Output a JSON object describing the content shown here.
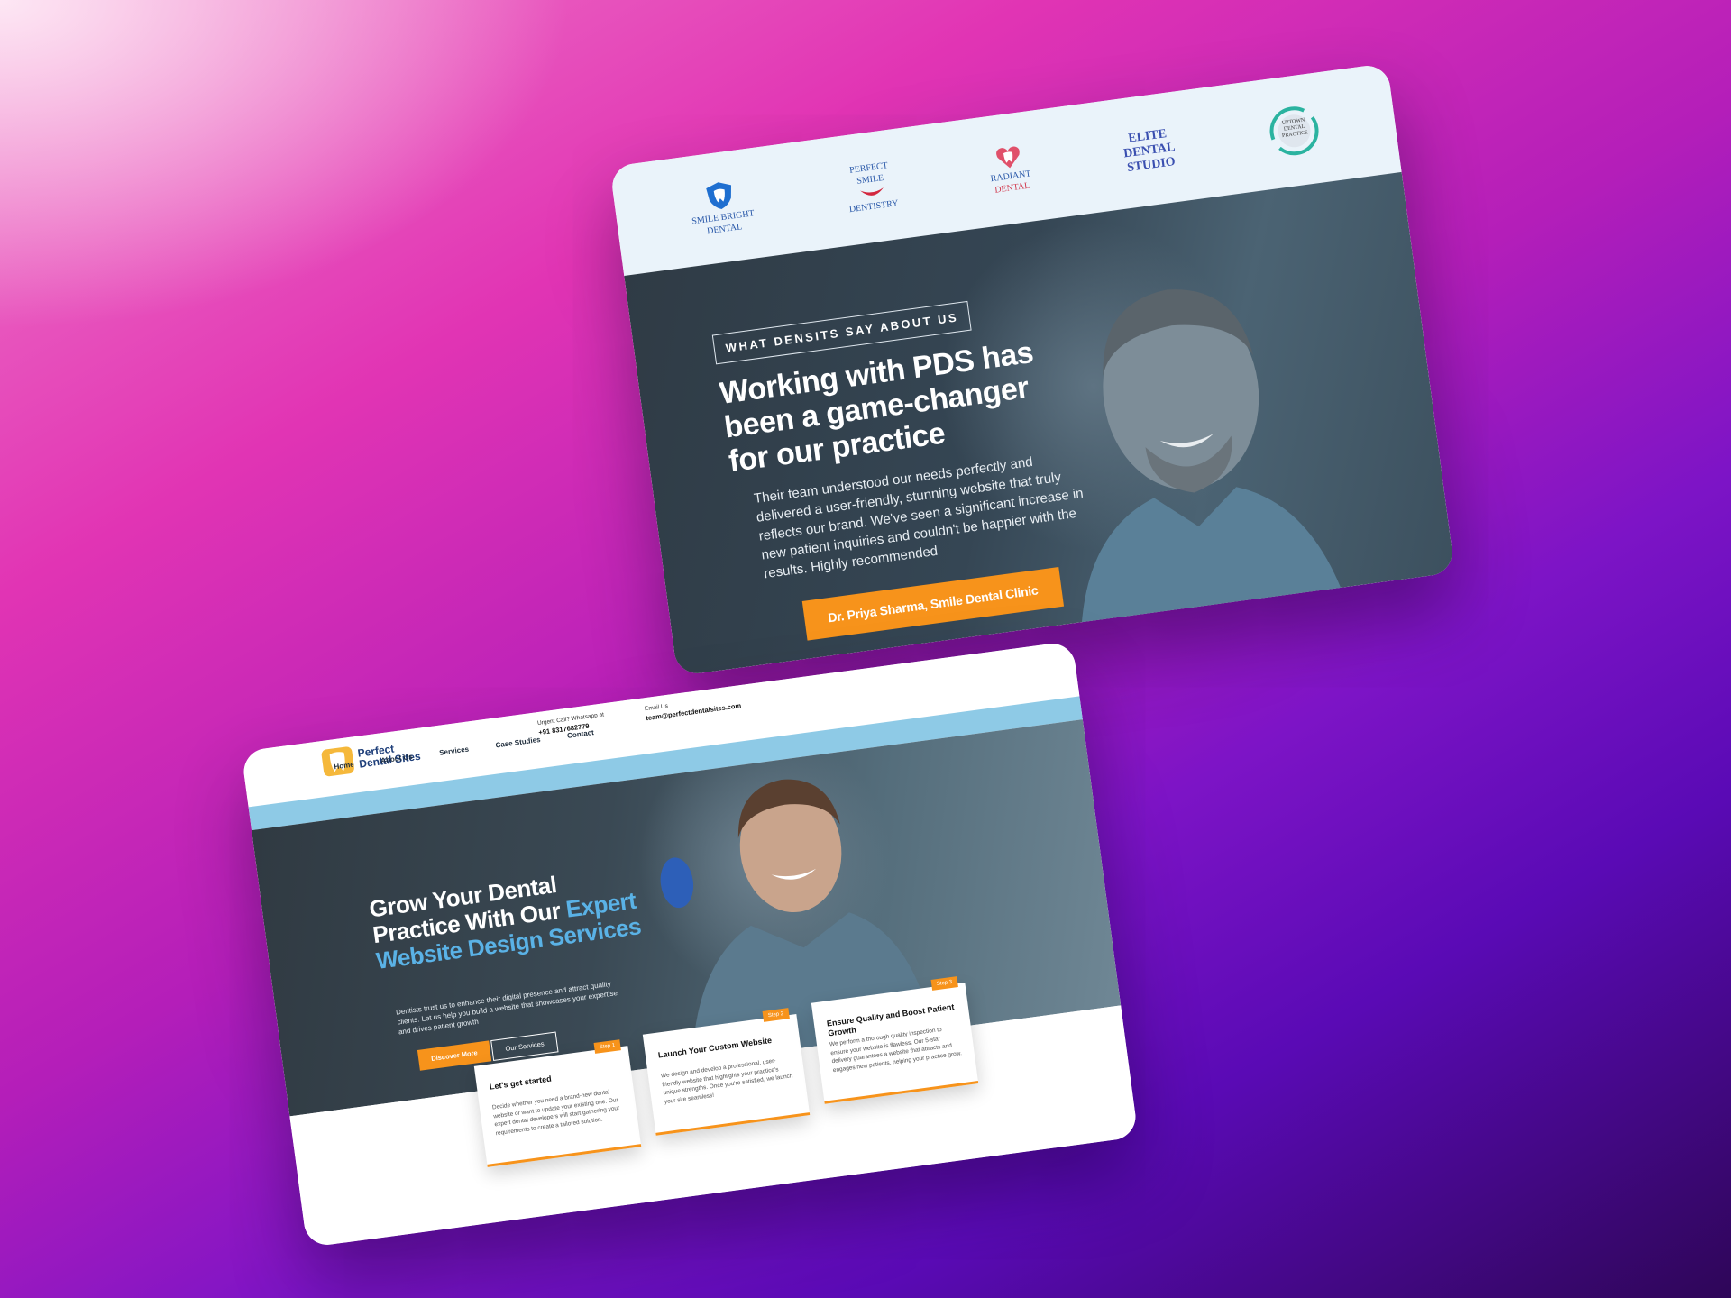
{
  "testimonial": {
    "logos": [
      {
        "icon": "shield-tooth-icon",
        "line1": "SMILE BRIGHT",
        "line2": "DENTAL"
      },
      {
        "icon": "smile-icon",
        "line1": "PERFECT",
        "line2": "SMILE",
        "line3": "DENTISTRY"
      },
      {
        "icon": "tooth-heart-icon",
        "line1": "RADIANT",
        "line2": "DENTAL"
      },
      {
        "icon": "none",
        "line1": "ELITE",
        "line2": "DENTAL",
        "line3": "STUDIO"
      },
      {
        "icon": "circle-tooth-icon",
        "line1": "UPTOWN",
        "line2": "DENTAL",
        "line3": "PRACTICE"
      }
    ],
    "eyebrow": "WHAT DENSITS SAY ABOUT US",
    "title": "Working with PDS has been a game-changer for our practice",
    "body": "Their team understood our needs perfectly and delivered a user-friendly, stunning website that truly reflects our brand. We've seen a significant increase in new patient inquiries and couldn't be happier with the results. Highly recommended",
    "author_button": "Dr. Priya Sharma, Smile Dental Clinic"
  },
  "home": {
    "brand": {
      "line1": "Perfect",
      "line2": "Dental Sites"
    },
    "contact_phone": {
      "label": "Urgent Call? Whatsapp at",
      "value": "+91 8317682779"
    },
    "contact_email": {
      "label": "Email Us",
      "value": "team@perfectdentalsites.com"
    },
    "nav": [
      "Home",
      "About Us",
      "Services",
      "Case Studies",
      "Contact"
    ],
    "hero_title_plain": "Grow Your Dental Practice With Our",
    "hero_title_highlight": "Expert Website Design Services",
    "hero_body": "Dentists trust us to enhance their digital presence and attract quality clients. Let us help you build a website that showcases your expertise and drives patient growth",
    "btn_primary": "Discover More",
    "btn_secondary": "Our Services",
    "steps": [
      {
        "tag": "Step 1",
        "title": "Let's get started",
        "body": "Decide whether you need a brand-new dental website or want to update your existing one. Our expert dental developers will start gathering your requirements to create a tailored solution."
      },
      {
        "tag": "Step 2",
        "title": "Launch Your Custom Website",
        "body": "We design and develop a professional, user-friendly website that highlights your practice's unique strengths. Once you're satisfied, we launch your site seamless!"
      },
      {
        "tag": "Step 3",
        "title": "Ensure Quality and Boost Patient Growth",
        "body": "We perform a thorough quality inspection to ensure your website is flawless. Our 5-star delivery guarantees a website that attracts and engages new patients, helping your practice grow."
      }
    ]
  },
  "colors": {
    "accent": "#f7931b",
    "highlight": "#5ab2e6",
    "nav_strip": "#8ecae6"
  }
}
